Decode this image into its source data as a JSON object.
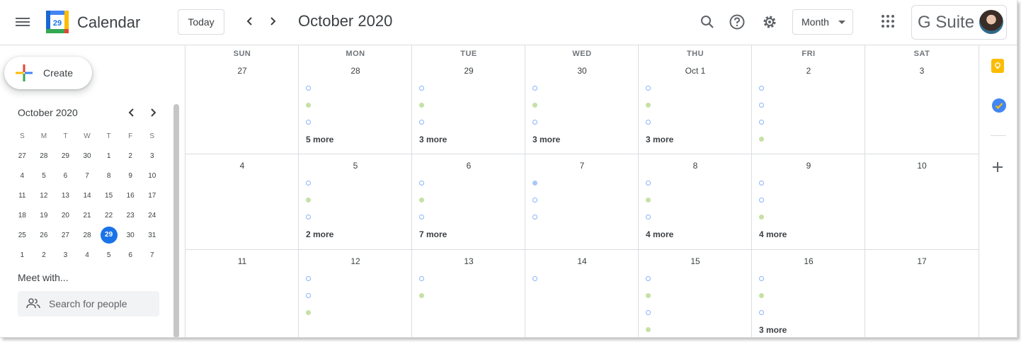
{
  "header": {
    "app_title": "Calendar",
    "logo_number": "29",
    "today_label": "Today",
    "month_title": "October 2020",
    "view_label": "Month",
    "brand": "G Suite"
  },
  "sidebar": {
    "create_label": "Create",
    "mini_title": "October 2020",
    "dow": [
      "S",
      "M",
      "T",
      "W",
      "T",
      "F",
      "S"
    ],
    "weeks": [
      [
        "27",
        "28",
        "29",
        "30",
        "1",
        "2",
        "3"
      ],
      [
        "4",
        "5",
        "6",
        "7",
        "8",
        "9",
        "10"
      ],
      [
        "11",
        "12",
        "13",
        "14",
        "15",
        "16",
        "17"
      ],
      [
        "18",
        "19",
        "20",
        "21",
        "22",
        "23",
        "24"
      ],
      [
        "25",
        "26",
        "27",
        "28",
        "29",
        "30",
        "31"
      ],
      [
        "1",
        "2",
        "3",
        "4",
        "5",
        "6",
        "7"
      ]
    ],
    "today": "29",
    "meet_title": "Meet with...",
    "search_placeholder": "Search for people"
  },
  "grid": {
    "dow": [
      "SUN",
      "MON",
      "TUE",
      "WED",
      "THU",
      "FRI",
      "SAT"
    ],
    "weeks": [
      [
        "27",
        "28",
        "29",
        "30",
        "Oct 1",
        "2",
        "3"
      ],
      [
        "4",
        "5",
        "6",
        "7",
        "8",
        "9",
        "10"
      ],
      [
        "11",
        "12",
        "13",
        "14",
        "15",
        "16",
        "17"
      ]
    ],
    "more": {
      "w0_mon": "5 more",
      "w0_tue": "3 more",
      "w0_wed": "3 more",
      "w0_thu": "3 more",
      "w1_mon": "2 more",
      "w1_tue": "7 more",
      "w1_thu": "4 more",
      "w1_fri": "4 more",
      "w2_fri": "3 more"
    }
  },
  "colors": {
    "accent": "#1a73e8",
    "event_blue": "#8ab4f8",
    "event_green": "#c5e1a5"
  },
  "icons": [
    "menu-icon",
    "calendar-logo-icon",
    "chevron-left-icon",
    "chevron-right-icon",
    "search-icon",
    "help-icon",
    "settings-icon",
    "apps-icon",
    "keep-icon",
    "tasks-icon",
    "plus-icon",
    "people-icon"
  ]
}
